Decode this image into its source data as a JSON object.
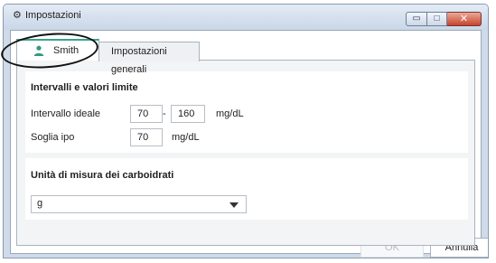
{
  "window": {
    "title": "Impostazioni",
    "title_icon": "gear-icon",
    "controls": {
      "minimize_icon": "minimize-icon",
      "maximize_icon": "maximize-icon",
      "close_icon": "close-icon",
      "minimize_glyph": "▭",
      "maximize_glyph": "□",
      "close_glyph": "✕"
    }
  },
  "tabs": [
    {
      "label": "Smith",
      "icon": "user-icon",
      "active": true
    },
    {
      "label": "Impostazioni generali",
      "active": false
    }
  ],
  "limits_section": {
    "heading": "Intervalli e valori limite",
    "ideal_range": {
      "label": "Intervallo ideale",
      "min": "70",
      "separator": "-",
      "max": "160",
      "unit": "mg/dL"
    },
    "hypo_threshold": {
      "label": "Soglia ipo",
      "value": "70",
      "unit": "mg/dL"
    }
  },
  "carbs_section": {
    "heading": "Unità di misura dei carboidrati",
    "selected": "g"
  },
  "footer": {
    "ok_label": "OK",
    "cancel_label": "Annulla"
  },
  "colors": {
    "active_tab_accent": "#3aa48a",
    "user_icon": "#2f9a7f",
    "close_button": "#c8442c",
    "annotation": "#111111"
  }
}
